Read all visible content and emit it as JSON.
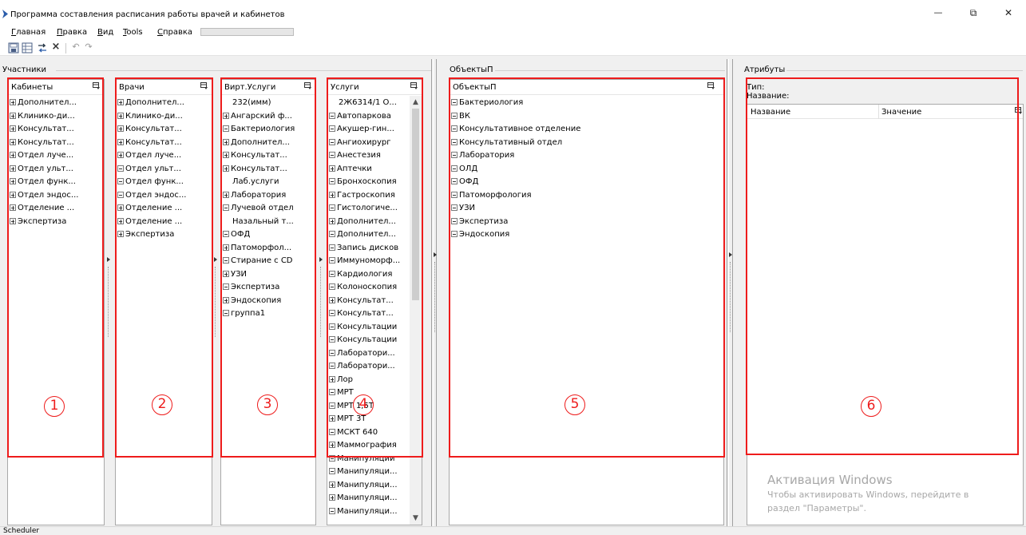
{
  "window": {
    "title": "Программа составления расписания работы врачей и кабинетов",
    "min_glyph": "—",
    "max_glyph": "⧉",
    "close_glyph": "✕"
  },
  "menu": {
    "items": [
      "Главная",
      "Правка",
      "Вид",
      "Tools",
      "Справка"
    ],
    "hotkeys": [
      "Г",
      "П",
      "В",
      "T",
      "С"
    ]
  },
  "toolbar": {
    "icons": [
      "save-icon",
      "grid-icon",
      "swap-arrows-icon",
      "delete-icon",
      "undo-icon",
      "redo-icon"
    ],
    "delete_glyph": "×",
    "undo_glyph": "↶",
    "redo_glyph": "↷"
  },
  "groups": {
    "participants": "Участники",
    "objects": "ОбъектыП",
    "attributes": "Атрибуты"
  },
  "panels": {
    "cabinets": {
      "title": "Кабинеты",
      "items": [
        {
          "t": "Дополнител...",
          "e": "+"
        },
        {
          "t": "Клинико-ди...",
          "e": "+"
        },
        {
          "t": "Консультат...",
          "e": "+"
        },
        {
          "t": "Консультат...",
          "e": "+"
        },
        {
          "t": "Отдел луче...",
          "e": "+"
        },
        {
          "t": "Отдел ульт...",
          "e": "+"
        },
        {
          "t": "Отдел функ...",
          "e": "+"
        },
        {
          "t": "Отдел эндос...",
          "e": "+"
        },
        {
          "t": "Отделение ...",
          "e": "+"
        },
        {
          "t": "Экспертиза",
          "e": "+"
        }
      ]
    },
    "doctors": {
      "title": "Врачи",
      "items": [
        {
          "t": "Дополнител...",
          "e": "+"
        },
        {
          "t": "Клинико-ди...",
          "e": "+"
        },
        {
          "t": "Консультат...",
          "e": "+"
        },
        {
          "t": "Консультат...",
          "e": "+"
        },
        {
          "t": "Отдел луче...",
          "e": "+"
        },
        {
          "t": "Отдел ульт...",
          "e": "-"
        },
        {
          "t": "Отдел функ...",
          "e": "-"
        },
        {
          "t": "Отдел эндос...",
          "e": "-"
        },
        {
          "t": "Отделение ...",
          "e": "+"
        },
        {
          "t": "Отделение ...",
          "e": "+"
        },
        {
          "t": "Экспертиза",
          "e": "+"
        }
      ]
    },
    "virtual_services": {
      "title": "Вирт.Услуги",
      "items": [
        {
          "t": "232(имм)",
          "e": ""
        },
        {
          "t": "Ангарский ф...",
          "e": "+"
        },
        {
          "t": "Бактериология",
          "e": "-"
        },
        {
          "t": "Дополнител...",
          "e": "+"
        },
        {
          "t": "Консультат...",
          "e": "+"
        },
        {
          "t": "Консультат...",
          "e": "+"
        },
        {
          "t": "Лаб.услуги",
          "e": ""
        },
        {
          "t": "Лаборатория",
          "e": "+"
        },
        {
          "t": "Лучевой отдел",
          "e": "-"
        },
        {
          "t": "Назальный т...",
          "e": ""
        },
        {
          "t": "ОФД",
          "e": "-"
        },
        {
          "t": "Патоморфол...",
          "e": "+"
        },
        {
          "t": "Стирание с CD",
          "e": "-"
        },
        {
          "t": "УЗИ",
          "e": "+"
        },
        {
          "t": "Экспертиза",
          "e": "-"
        },
        {
          "t": "Эндоскопия",
          "e": "+"
        },
        {
          "t": "группа1",
          "e": "-"
        }
      ]
    },
    "services": {
      "title": "Услуги",
      "items": [
        {
          "t": "2Ж6314/1 О...",
          "e": ""
        },
        {
          "t": "Автопаркова",
          "e": "-"
        },
        {
          "t": "Акушер-гин...",
          "e": "-"
        },
        {
          "t": "Ангиохирург",
          "e": "-"
        },
        {
          "t": "Анестезия",
          "e": "-"
        },
        {
          "t": "Аптечки",
          "e": "+"
        },
        {
          "t": "Бронхоскопия",
          "e": "-"
        },
        {
          "t": "Гастроскопия",
          "e": "+"
        },
        {
          "t": "Гистологиче...",
          "e": "-"
        },
        {
          "t": "Дополнител...",
          "e": "+"
        },
        {
          "t": "Дополнител...",
          "e": "-"
        },
        {
          "t": "Запись дисков",
          "e": "-"
        },
        {
          "t": "Иммуноморф...",
          "e": "-"
        },
        {
          "t": "Кардиология",
          "e": "-"
        },
        {
          "t": "Колоноскопия",
          "e": "-"
        },
        {
          "t": "Консультат...",
          "e": "+"
        },
        {
          "t": "Консультат...",
          "e": "-"
        },
        {
          "t": "Консультации",
          "e": "-"
        },
        {
          "t": "Консультации",
          "e": "-"
        },
        {
          "t": "Лаборатори...",
          "e": "-"
        },
        {
          "t": "Лаборатори...",
          "e": "-"
        },
        {
          "t": "Лор",
          "e": "+"
        },
        {
          "t": "МРТ",
          "e": "-"
        },
        {
          "t": "МРТ 1,5Т",
          "e": "-"
        },
        {
          "t": "МРТ 3Т",
          "e": "+"
        },
        {
          "t": "МСКТ 640",
          "e": "-"
        },
        {
          "t": "Маммография",
          "e": "+"
        },
        {
          "t": "Манипуляции",
          "e": "-"
        },
        {
          "t": "Манипуляци...",
          "e": "-"
        },
        {
          "t": "Манипуляци...",
          "e": "+"
        },
        {
          "t": "Манипуляци...",
          "e": "+"
        },
        {
          "t": "Манипуляци...",
          "e": "-"
        }
      ]
    },
    "objects": {
      "title": "ОбъектыП",
      "items": [
        {
          "t": "Бактериология",
          "e": "-"
        },
        {
          "t": "ВК",
          "e": "-"
        },
        {
          "t": "Консультативное отделение",
          "e": "-"
        },
        {
          "t": "Консультативный отдел",
          "e": "-"
        },
        {
          "t": "Лаборатория",
          "e": "-"
        },
        {
          "t": "ОЛД",
          "e": "-"
        },
        {
          "t": "ОФД",
          "e": "-"
        },
        {
          "t": "Патоморфология",
          "e": "-"
        },
        {
          "t": "УЗИ",
          "e": "-"
        },
        {
          "t": "Экспертиза",
          "e": "-"
        },
        {
          "t": "Эндоскопия",
          "e": "-"
        }
      ]
    }
  },
  "attributes": {
    "type_label": "Тип:",
    "name_label": "Название:",
    "col_name": "Название",
    "col_value": "Значение"
  },
  "annotations": [
    "1",
    "2",
    "3",
    "4",
    "5",
    "6"
  ],
  "watermark": {
    "line1": "Активация Windows",
    "line2": "Чтобы активировать Windows, перейдите в",
    "line3": "раздел \"Параметры\"."
  },
  "status": {
    "text": "Scheduler"
  },
  "colors": {
    "annotation_red": "#ee1c1c",
    "watermark_gray": "#a7a7a7"
  }
}
